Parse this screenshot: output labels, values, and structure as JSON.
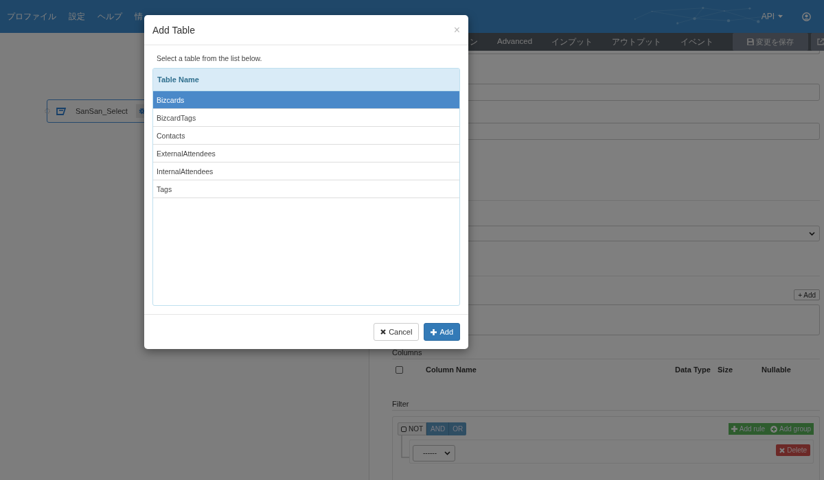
{
  "navbar": {
    "menu": [
      "プロファイル",
      "設定",
      "ヘルプ",
      "情"
    ],
    "api_menu": "API"
  },
  "canvas": {
    "node": {
      "label": "SanSan_Select"
    }
  },
  "panel": {
    "tabs": [
      "ン",
      "Advanced",
      "インプット",
      "アウトプット",
      "イベント"
    ],
    "save_button": "変更を保存",
    "add_button": "+ Add",
    "columns": {
      "title": "Columns",
      "all_checked": false,
      "headers": [
        "Column Name",
        "Data Type",
        "Size",
        "Nullable"
      ]
    },
    "filter": {
      "title": "Filter",
      "not": {
        "label": "NOT",
        "checked": false
      },
      "conditions": [
        "AND",
        "OR"
      ],
      "add_rule": "Add rule",
      "add_group": "Add group",
      "rule": {
        "field_value": "------",
        "delete": "Delete"
      }
    }
  },
  "modal": {
    "title": "Add Table",
    "close": "×",
    "instruction": "Select a table from the list below.",
    "table": {
      "header": "Table Name",
      "rows": [
        {
          "name": "Bizcards",
          "selected": true
        },
        {
          "name": "BizcardTags",
          "selected": false
        },
        {
          "name": "Contacts",
          "selected": false
        },
        {
          "name": "ExternalAttendees",
          "selected": false
        },
        {
          "name": "InternalAttendees",
          "selected": false
        },
        {
          "name": "Tags",
          "selected": false
        }
      ]
    },
    "buttons": [
      {
        "kind": "cancel",
        "label": "Cancel"
      },
      {
        "kind": "add",
        "label": "Add"
      }
    ]
  }
}
